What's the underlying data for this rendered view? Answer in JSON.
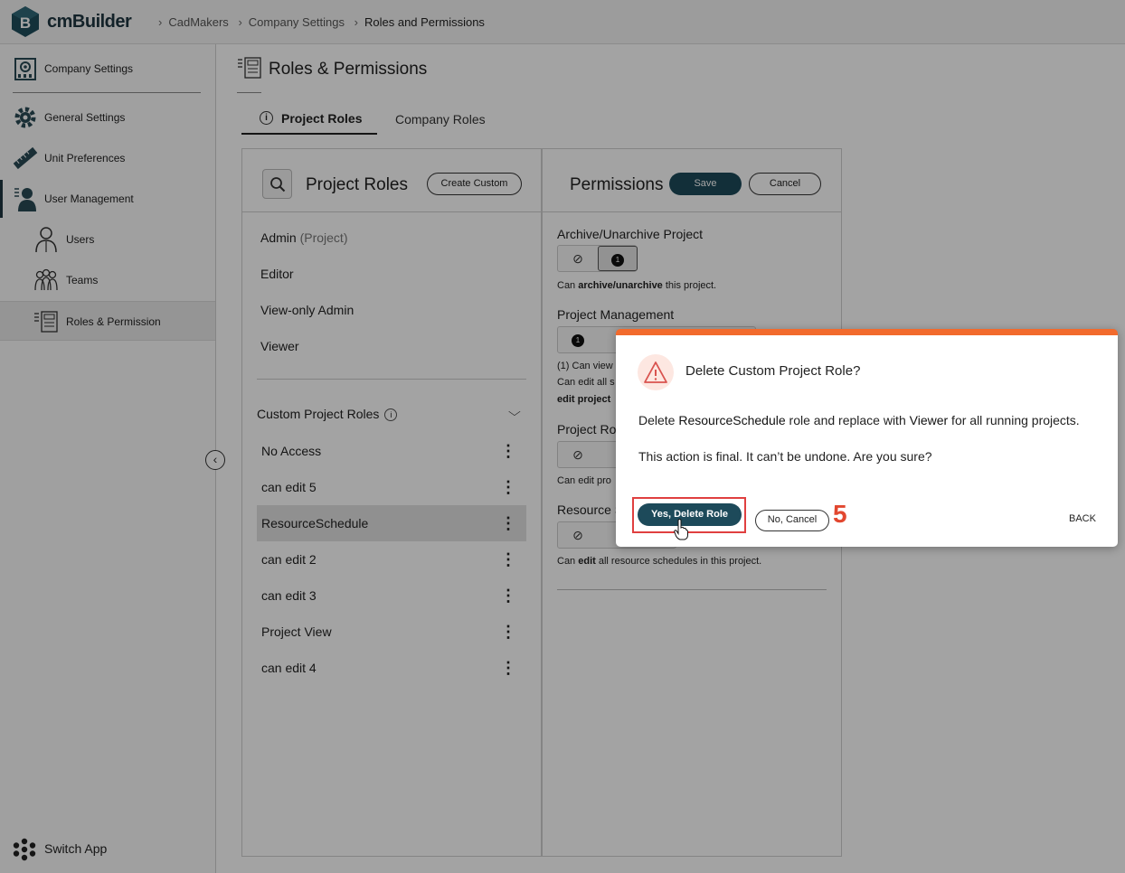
{
  "app": {
    "name": "cmBuilder",
    "logo_letter": "B"
  },
  "breadcrumb": [
    "CadMakers",
    "Company Settings",
    "Roles and Permissions"
  ],
  "sidebar": {
    "items": [
      {
        "label": "Company Settings",
        "icon": "building-icon"
      },
      {
        "label": "General Settings",
        "icon": "gear-icon"
      },
      {
        "label": "Unit Preferences",
        "icon": "ruler-icon"
      },
      {
        "label": "User Management",
        "icon": "user-admin-icon"
      },
      {
        "label": "Users",
        "icon": "user-icon"
      },
      {
        "label": "Teams",
        "icon": "team-icon"
      },
      {
        "label": "Roles & Permission",
        "icon": "roles-icon",
        "active": true
      }
    ],
    "switch_app": "Switch App",
    "collapse_glyph": "‹"
  },
  "page": {
    "title": "Roles & Permissions",
    "tabs": [
      {
        "label": "Project Roles",
        "active": true
      },
      {
        "label": "Company Roles",
        "active": false
      }
    ]
  },
  "roles_panel": {
    "title": "Project Roles",
    "create_button": "Create Custom",
    "default_roles": [
      {
        "name": "Admin",
        "suffix": "(Project)"
      },
      {
        "name": "Editor",
        "suffix": ""
      },
      {
        "name": "View-only Admin",
        "suffix": ""
      },
      {
        "name": "Viewer",
        "suffix": ""
      }
    ],
    "custom_header": "Custom Project Roles",
    "info_glyph": "i",
    "chevron_glyph": "⌵",
    "kebab_glyph": "⋮",
    "custom_roles": [
      "No Access",
      "can edit 5",
      "ResourceSchedule",
      "can edit 2",
      "can edit 3",
      "Project View",
      "can edit 4"
    ],
    "selected_custom_role": "ResourceSchedule"
  },
  "permissions_panel": {
    "title": "Permissions",
    "save_button": "Save",
    "cancel_button": "Cancel",
    "deny_glyph": "⃠",
    "sections": [
      {
        "label": "Archive/Unarchive Project",
        "badge": "1",
        "desc_prefix": "Can ",
        "desc_bold": "archive/unarchive",
        "desc_suffix": " this project."
      },
      {
        "label": "Project Management",
        "badge": "1",
        "desc_lines": [
          "(1) Can view",
          "Can edit all s",
          "edit project"
        ]
      },
      {
        "label": "Project Ro",
        "desc": "Can edit pro"
      },
      {
        "label": "Resource S",
        "desc_prefix": "Can ",
        "desc_bold": "edit",
        "desc_suffix": " all resource schedules in this project."
      }
    ]
  },
  "dialog": {
    "title": "Delete Custom Project Role?",
    "message_prefix": "Delete ",
    "role_name": "ResourceSchedule",
    "message_middle": " role and replace with ",
    "replacement_role": "Viewer",
    "message_suffix": " for all running projects.",
    "warning": "This action is final. It can’t be undone. Are you sure?",
    "confirm_button": "Yes, Delete Role",
    "cancel_button": "No, Cancel",
    "back_link": "BACK",
    "step_number": "5",
    "accent_color": "#f26a2c",
    "highlight_color": "#e04040"
  },
  "colors": {
    "primary": "#1d4a5a",
    "brand_dark": "#1f3640"
  }
}
